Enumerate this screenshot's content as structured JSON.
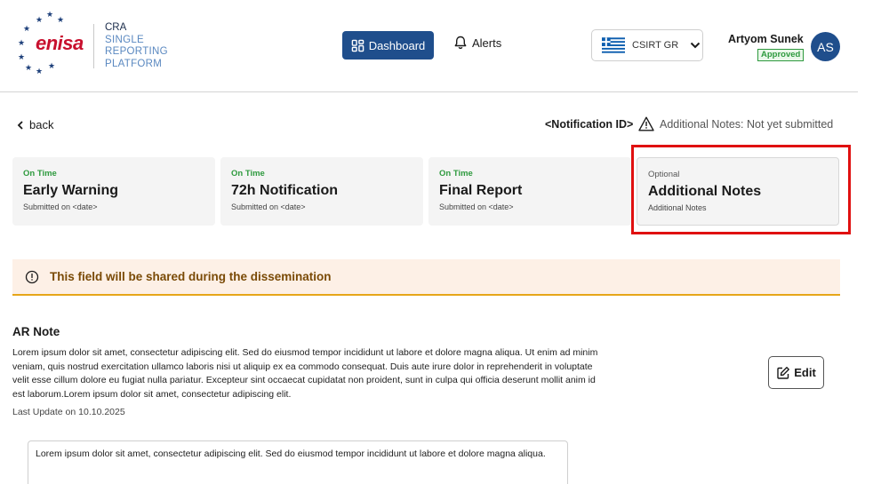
{
  "brand": {
    "logo_text": "enisa",
    "platform_lines": [
      "CRA",
      "SINGLE",
      "REPORTING",
      "PLATFORM"
    ],
    "accent_red": "#c8102e",
    "accent_blue": "#1f4e8c"
  },
  "nav": {
    "dashboard_label": "Dashboard",
    "alerts_label": "Alerts"
  },
  "country": {
    "value": "CSIRT GR",
    "flag": "greece-flag-icon"
  },
  "user": {
    "name": "Artyom Sunek",
    "status": "Approved",
    "initials": "AS"
  },
  "subbar": {
    "back_label": "back",
    "notification_id": "<Notification ID>",
    "status_text": "Additional Notes: Not yet submitted"
  },
  "steps": [
    {
      "state": "On Time",
      "title": "Early Warning",
      "subtitle": "Submitted on <date>"
    },
    {
      "state": "On Time",
      "title": "72h Notification",
      "subtitle": "Submitted on <date>"
    },
    {
      "state": "On Time",
      "title": "Final Report",
      "subtitle": "Submitted on <date>"
    },
    {
      "state": "Optional",
      "title": "Additional Notes",
      "subtitle": "Additional Notes"
    }
  ],
  "banner": {
    "text": "This field will be shared during the dissemination",
    "color": "#e6a619"
  },
  "note": {
    "title": "AR Note",
    "body": "Lorem ipsum dolor sit amet, consectetur adipiscing elit. Sed do eiusmod tempor incididunt ut labore et dolore magna aliqua. Ut enim ad minim veniam, quis nostrud exercitation ullamco laboris nisi ut aliquip ex ea commodo consequat. Duis aute irure dolor in reprehenderit in voluptate velit esse cillum dolore eu fugiat nulla pariatur. Excepteur sint occaecat cupidatat non proident, sunt in culpa qui officia deserunt mollit anim id est laborum.Lorem ipsum dolor sit amet, consectetur adipiscing elit.",
    "last_update": "Last Update on 10.10.2025",
    "edit_label": "Edit"
  },
  "input": {
    "value": "Lorem ipsum dolor sit amet, consectetur adipiscing elit. Sed do eiusmod tempor incididunt ut labore et dolore magna aliqua."
  }
}
